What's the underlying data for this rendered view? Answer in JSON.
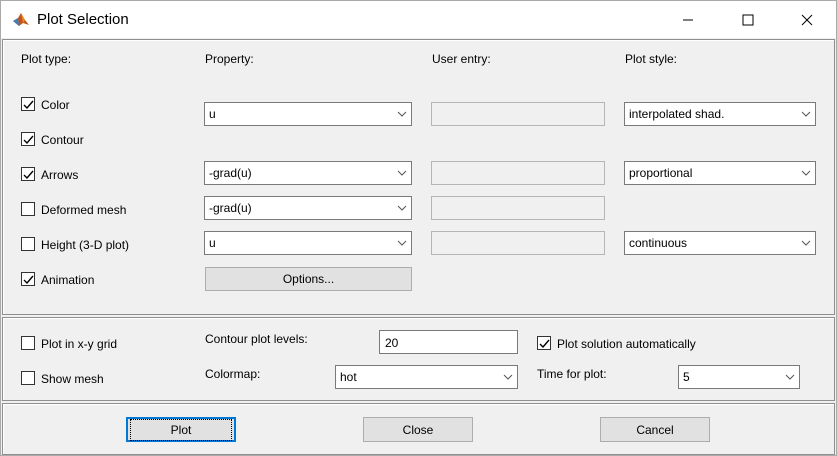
{
  "window": {
    "title": "Plot Selection"
  },
  "headers": {
    "plot_type": "Plot type:",
    "property": "Property:",
    "user_entry": "User entry:",
    "plot_style": "Plot style:"
  },
  "plot_types": [
    {
      "label": "Color",
      "checked": true
    },
    {
      "label": "Contour",
      "checked": true
    },
    {
      "label": "Arrows",
      "checked": true
    },
    {
      "label": "Deformed mesh",
      "checked": false
    },
    {
      "label": "Height (3-D plot)",
      "checked": false
    },
    {
      "label": "Animation",
      "checked": true
    }
  ],
  "properties": {
    "color": "u",
    "arrows": "-grad(u)",
    "deformed": "-grad(u)",
    "height": "u"
  },
  "styles": {
    "color": "interpolated shad.",
    "arrows": "proportional",
    "height": "continuous"
  },
  "options_button": "Options...",
  "grid_options": {
    "plot_in_grid": {
      "label": "Plot in x-y grid",
      "checked": false
    },
    "show_mesh": {
      "label": "Show mesh",
      "checked": false
    },
    "contour_levels_label": "Contour plot levels:",
    "contour_levels_value": "20",
    "colormap_label": "Colormap:",
    "colormap_value": "hot",
    "auto_plot": {
      "label": "Plot solution automatically",
      "checked": true
    },
    "time_label": "Time for plot:",
    "time_value": "5"
  },
  "buttons": {
    "plot": "Plot",
    "close": "Close",
    "cancel": "Cancel"
  }
}
